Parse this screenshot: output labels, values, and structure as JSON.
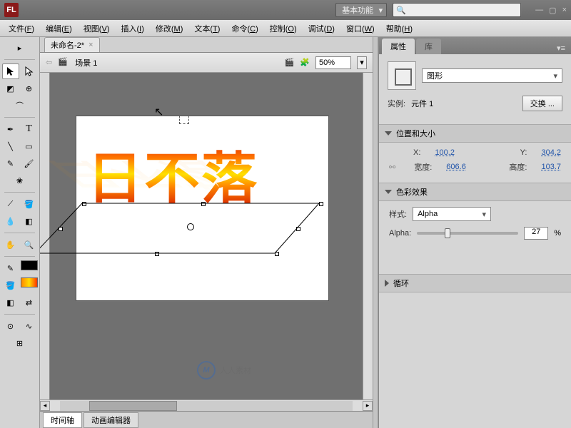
{
  "app": {
    "logo": "FL"
  },
  "workspace": {
    "label": "基本功能"
  },
  "search": {
    "placeholder": ""
  },
  "menus": [
    {
      "t": "文件",
      "k": "F"
    },
    {
      "t": "编辑",
      "k": "E"
    },
    {
      "t": "视图",
      "k": "V"
    },
    {
      "t": "插入",
      "k": "I"
    },
    {
      "t": "修改",
      "k": "M"
    },
    {
      "t": "文本",
      "k": "T"
    },
    {
      "t": "命令",
      "k": "C"
    },
    {
      "t": "控制",
      "k": "O"
    },
    {
      "t": "调试",
      "k": "D"
    },
    {
      "t": "窗口",
      "k": "W"
    },
    {
      "t": "帮助",
      "k": "H"
    }
  ],
  "document": {
    "tab": "未命名-2*",
    "scene": "场景 1",
    "zoom": "50%"
  },
  "artwork": {
    "text": "日不落"
  },
  "timeline": {
    "tab1": "时间轴",
    "tab2": "动画编辑器"
  },
  "props": {
    "tab1": "属性",
    "tab2": "库",
    "type_label": "图形",
    "instance_key": "实例:",
    "instance_val": "元件 1",
    "swap_btn": "交换 ...",
    "sec_pos": "位置和大小",
    "x_key": "X:",
    "x_val": "100.2",
    "y_key": "Y:",
    "y_val": "304.2",
    "w_key": "宽度:",
    "w_val": "606.6",
    "h_key": "高度:",
    "h_val": "103.7",
    "sec_color": "色彩效果",
    "style_key": "样式:",
    "style_val": "Alpha",
    "alpha_key": "Alpha:",
    "alpha_val": "27",
    "alpha_unit": "%",
    "sec_loop": "循环"
  },
  "watermark": {
    "logo": "M",
    "text": "人人素材"
  }
}
